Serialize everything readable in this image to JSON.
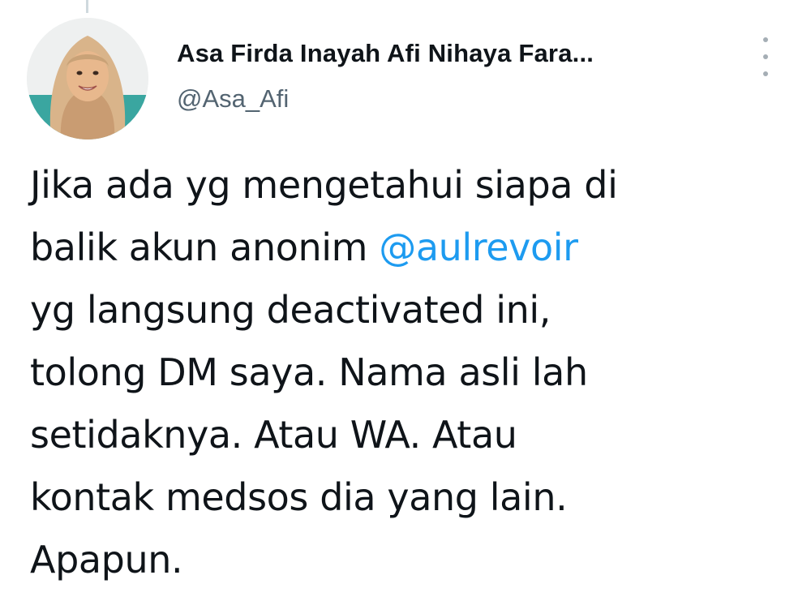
{
  "author": {
    "display_name": "Asa Firda Inayah Afi Nihaya Fara...",
    "handle": "@Asa_Afi"
  },
  "tweet": {
    "line1": "Jika ada yg mengetahui siapa di",
    "line2_prefix": "balik akun anonim ",
    "mention": "@aulrevoir",
    "line3": "yg langsung deactivated ini,",
    "line4": "tolong DM saya. Nama asli lah",
    "line5": "setidaknya. Atau WA. Atau",
    "line6": "kontak medsos dia yang lain.",
    "line7": "Apapun."
  },
  "icons": {
    "more": "more-vertical-icon",
    "avatar": "profile-photo"
  },
  "colors": {
    "mention": "#1d9bf0",
    "handle": "#536471",
    "text": "#0f1419"
  }
}
